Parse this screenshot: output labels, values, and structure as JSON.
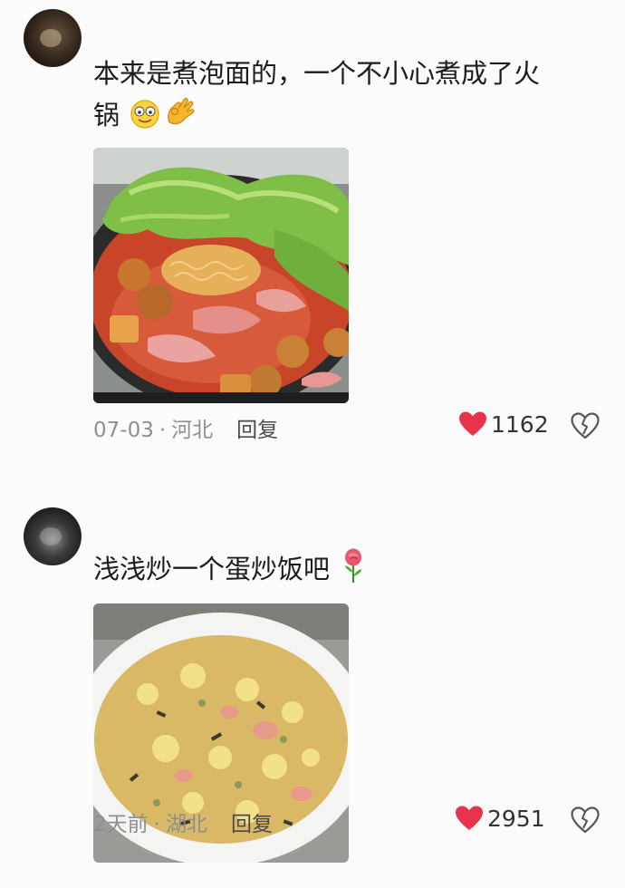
{
  "comments": [
    {
      "text_line1": "本来是煮泡面的，一个不小心煮成了火",
      "text_line2": "锅",
      "emojis": [
        "smiley-face-icon",
        "ok-hand-icon"
      ],
      "image": "hotpot-photo",
      "date": "07-03",
      "location": "河北",
      "reply_label": "回复",
      "like_count": "1162"
    },
    {
      "text": "浅浅炒一个蛋炒饭吧",
      "emojis": [
        "rose-icon"
      ],
      "image": "fried-rice-photo",
      "date": "2天前",
      "location": "湖北",
      "reply_label": "回复",
      "like_count": "2951"
    }
  ],
  "colors": {
    "like": "#e8344a",
    "meta_text": "#8f8f8f",
    "body_text": "#1c1c1c"
  }
}
